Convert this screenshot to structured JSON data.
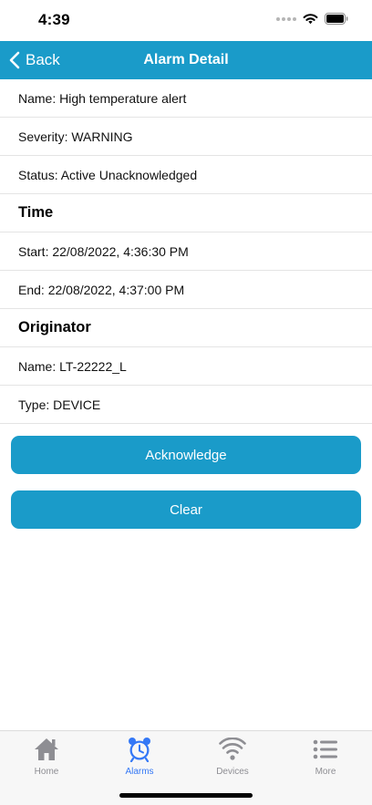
{
  "status_bar": {
    "time": "4:39"
  },
  "nav": {
    "back_label": "Back",
    "title": "Alarm Detail"
  },
  "details": {
    "name": "Name: High temperature alert",
    "severity": "Severity: WARNING",
    "status": "Status: Active Unacknowledged"
  },
  "time_section": {
    "header": "Time",
    "start": "Start: 22/08/2022, 4:36:30 PM",
    "end": "End: 22/08/2022, 4:37:00 PM"
  },
  "originator_section": {
    "header": "Originator",
    "name": "Name: LT-22222_L",
    "type": "Type: DEVICE"
  },
  "actions": {
    "acknowledge_label": "Acknowledge",
    "clear_label": "Clear"
  },
  "tab_bar": {
    "active_tab": "Alarms",
    "tabs": [
      {
        "label": "Home",
        "icon": "home-icon"
      },
      {
        "label": "Alarms",
        "icon": "alarm-clock-icon"
      },
      {
        "label": "Devices",
        "icon": "wifi-icon"
      },
      {
        "label": "More",
        "icon": "list-icon"
      }
    ]
  },
  "colors": {
    "accent": "#1a9bc9",
    "tab_active": "#3478f6",
    "tab_inactive": "#8e8e93"
  }
}
